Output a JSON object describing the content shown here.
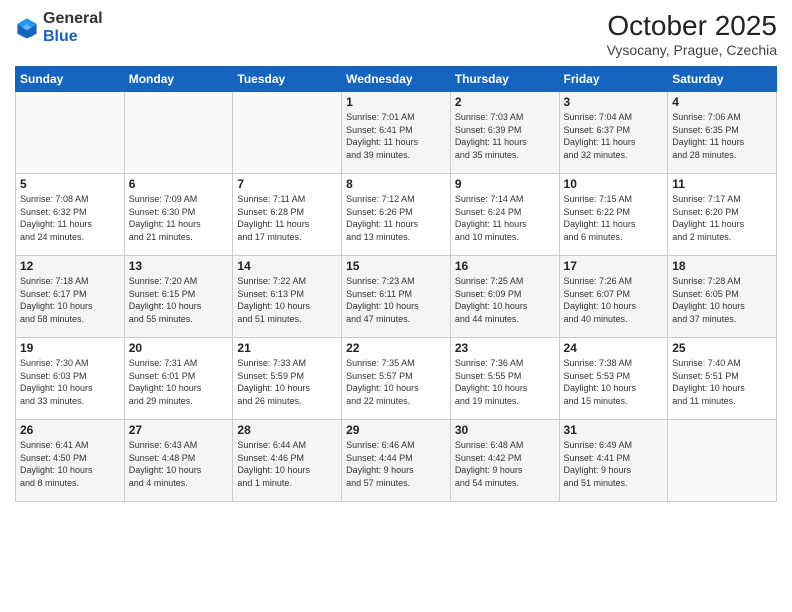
{
  "logo": {
    "general": "General",
    "blue": "Blue"
  },
  "header": {
    "month": "October 2025",
    "location": "Vysocany, Prague, Czechia"
  },
  "days_of_week": [
    "Sunday",
    "Monday",
    "Tuesday",
    "Wednesday",
    "Thursday",
    "Friday",
    "Saturday"
  ],
  "weeks": [
    [
      {
        "day": "",
        "info": ""
      },
      {
        "day": "",
        "info": ""
      },
      {
        "day": "",
        "info": ""
      },
      {
        "day": "1",
        "info": "Sunrise: 7:01 AM\nSunset: 6:41 PM\nDaylight: 11 hours\nand 39 minutes."
      },
      {
        "day": "2",
        "info": "Sunrise: 7:03 AM\nSunset: 6:39 PM\nDaylight: 11 hours\nand 35 minutes."
      },
      {
        "day": "3",
        "info": "Sunrise: 7:04 AM\nSunset: 6:37 PM\nDaylight: 11 hours\nand 32 minutes."
      },
      {
        "day": "4",
        "info": "Sunrise: 7:06 AM\nSunset: 6:35 PM\nDaylight: 11 hours\nand 28 minutes."
      }
    ],
    [
      {
        "day": "5",
        "info": "Sunrise: 7:08 AM\nSunset: 6:32 PM\nDaylight: 11 hours\nand 24 minutes."
      },
      {
        "day": "6",
        "info": "Sunrise: 7:09 AM\nSunset: 6:30 PM\nDaylight: 11 hours\nand 21 minutes."
      },
      {
        "day": "7",
        "info": "Sunrise: 7:11 AM\nSunset: 6:28 PM\nDaylight: 11 hours\nand 17 minutes."
      },
      {
        "day": "8",
        "info": "Sunrise: 7:12 AM\nSunset: 6:26 PM\nDaylight: 11 hours\nand 13 minutes."
      },
      {
        "day": "9",
        "info": "Sunrise: 7:14 AM\nSunset: 6:24 PM\nDaylight: 11 hours\nand 10 minutes."
      },
      {
        "day": "10",
        "info": "Sunrise: 7:15 AM\nSunset: 6:22 PM\nDaylight: 11 hours\nand 6 minutes."
      },
      {
        "day": "11",
        "info": "Sunrise: 7:17 AM\nSunset: 6:20 PM\nDaylight: 11 hours\nand 2 minutes."
      }
    ],
    [
      {
        "day": "12",
        "info": "Sunrise: 7:18 AM\nSunset: 6:17 PM\nDaylight: 10 hours\nand 58 minutes."
      },
      {
        "day": "13",
        "info": "Sunrise: 7:20 AM\nSunset: 6:15 PM\nDaylight: 10 hours\nand 55 minutes."
      },
      {
        "day": "14",
        "info": "Sunrise: 7:22 AM\nSunset: 6:13 PM\nDaylight: 10 hours\nand 51 minutes."
      },
      {
        "day": "15",
        "info": "Sunrise: 7:23 AM\nSunset: 6:11 PM\nDaylight: 10 hours\nand 47 minutes."
      },
      {
        "day": "16",
        "info": "Sunrise: 7:25 AM\nSunset: 6:09 PM\nDaylight: 10 hours\nand 44 minutes."
      },
      {
        "day": "17",
        "info": "Sunrise: 7:26 AM\nSunset: 6:07 PM\nDaylight: 10 hours\nand 40 minutes."
      },
      {
        "day": "18",
        "info": "Sunrise: 7:28 AM\nSunset: 6:05 PM\nDaylight: 10 hours\nand 37 minutes."
      }
    ],
    [
      {
        "day": "19",
        "info": "Sunrise: 7:30 AM\nSunset: 6:03 PM\nDaylight: 10 hours\nand 33 minutes."
      },
      {
        "day": "20",
        "info": "Sunrise: 7:31 AM\nSunset: 6:01 PM\nDaylight: 10 hours\nand 29 minutes."
      },
      {
        "day": "21",
        "info": "Sunrise: 7:33 AM\nSunset: 5:59 PM\nDaylight: 10 hours\nand 26 minutes."
      },
      {
        "day": "22",
        "info": "Sunrise: 7:35 AM\nSunset: 5:57 PM\nDaylight: 10 hours\nand 22 minutes."
      },
      {
        "day": "23",
        "info": "Sunrise: 7:36 AM\nSunset: 5:55 PM\nDaylight: 10 hours\nand 19 minutes."
      },
      {
        "day": "24",
        "info": "Sunrise: 7:38 AM\nSunset: 5:53 PM\nDaylight: 10 hours\nand 15 minutes."
      },
      {
        "day": "25",
        "info": "Sunrise: 7:40 AM\nSunset: 5:51 PM\nDaylight: 10 hours\nand 11 minutes."
      }
    ],
    [
      {
        "day": "26",
        "info": "Sunrise: 6:41 AM\nSunset: 4:50 PM\nDaylight: 10 hours\nand 8 minutes."
      },
      {
        "day": "27",
        "info": "Sunrise: 6:43 AM\nSunset: 4:48 PM\nDaylight: 10 hours\nand 4 minutes."
      },
      {
        "day": "28",
        "info": "Sunrise: 6:44 AM\nSunset: 4:46 PM\nDaylight: 10 hours\nand 1 minute."
      },
      {
        "day": "29",
        "info": "Sunrise: 6:46 AM\nSunset: 4:44 PM\nDaylight: 9 hours\nand 57 minutes."
      },
      {
        "day": "30",
        "info": "Sunrise: 6:48 AM\nSunset: 4:42 PM\nDaylight: 9 hours\nand 54 minutes."
      },
      {
        "day": "31",
        "info": "Sunrise: 6:49 AM\nSunset: 4:41 PM\nDaylight: 9 hours\nand 51 minutes."
      },
      {
        "day": "",
        "info": ""
      }
    ]
  ]
}
